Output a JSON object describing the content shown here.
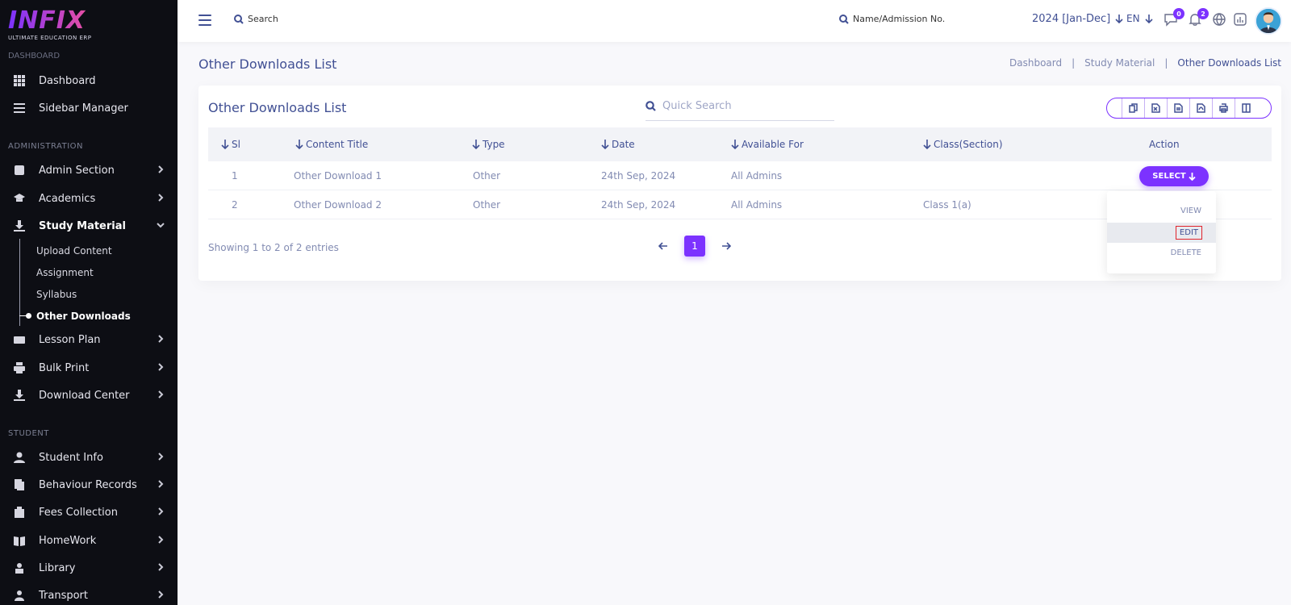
{
  "brand": {
    "logo_text": "INFIX",
    "tagline": "ULTIMATE EDUCATION ERP"
  },
  "sidebar": {
    "cut_section": "DASHBOARD",
    "top_items": [
      {
        "label": "Dashboard",
        "icon": "grid-icon"
      },
      {
        "label": "Sidebar Manager",
        "icon": "list-icon"
      }
    ],
    "sections": [
      "ADMINISTRATION",
      "STUDENT"
    ],
    "admin_items": [
      {
        "label": "Admin Section",
        "icon": "admin-icon"
      },
      {
        "label": "Academics",
        "icon": "graduation-cap-icon"
      },
      {
        "label": "Study Material",
        "icon": "download-icon"
      }
    ],
    "study_sub": [
      "Upload Content",
      "Assignment",
      "Syllabus",
      "Other Downloads"
    ],
    "more_items": [
      {
        "label": "Lesson Plan",
        "icon": "keyboard-icon"
      },
      {
        "label": "Bulk Print",
        "icon": "printer-icon"
      },
      {
        "label": "Download Center",
        "icon": "download-icon"
      }
    ],
    "student_items": [
      {
        "label": "Student Info",
        "icon": "user-icon"
      },
      {
        "label": "Behaviour Records",
        "icon": "records-icon"
      },
      {
        "label": "Fees Collection",
        "icon": "fees-icon"
      },
      {
        "label": "HomeWork",
        "icon": "book-icon"
      },
      {
        "label": "Library",
        "icon": "library-icon"
      },
      {
        "label": "Transport",
        "icon": "transport-icon"
      }
    ]
  },
  "topbar": {
    "search_label": "Search",
    "admission_search": "Name/Admission No.",
    "year": "2024 [Jan-Dec]",
    "language": "EN",
    "messages_count": "0",
    "notifications_count": "2"
  },
  "page": {
    "title": "Other Downloads List",
    "breadcrumb": [
      "Dashboard",
      "Study Material",
      "Other Downloads List"
    ]
  },
  "card": {
    "title": "Other Downloads List",
    "quick_search_placeholder": "Quick Search",
    "export_icons": [
      "copy-icon",
      "excel-icon",
      "csv-icon",
      "pdf-icon",
      "print-icon",
      "columns-icon"
    ]
  },
  "table": {
    "headers": [
      "Sl",
      "Content Title",
      "Type",
      "Date",
      "Available For",
      "Class(Section)",
      "Action"
    ],
    "rows": [
      {
        "sl": "1",
        "title": "Other Download 1",
        "type": "Other",
        "date": "24th Sep, 2024",
        "available": "All Admins",
        "class": ""
      },
      {
        "sl": "2",
        "title": "Other Download 2",
        "type": "Other",
        "date": "24th Sep, 2024",
        "available": "All Admins",
        "class": "Class 1(a)"
      }
    ],
    "select_label": "SELECT",
    "dropdown": [
      "VIEW",
      "EDIT",
      "DELETE"
    ],
    "showing": "Showing 1 to 2 of 2 entries",
    "current_page": "1"
  },
  "colors": {
    "accent": "#7c32ff",
    "primary_text": "#415094",
    "sidebar_bg": "#0d0e14"
  }
}
